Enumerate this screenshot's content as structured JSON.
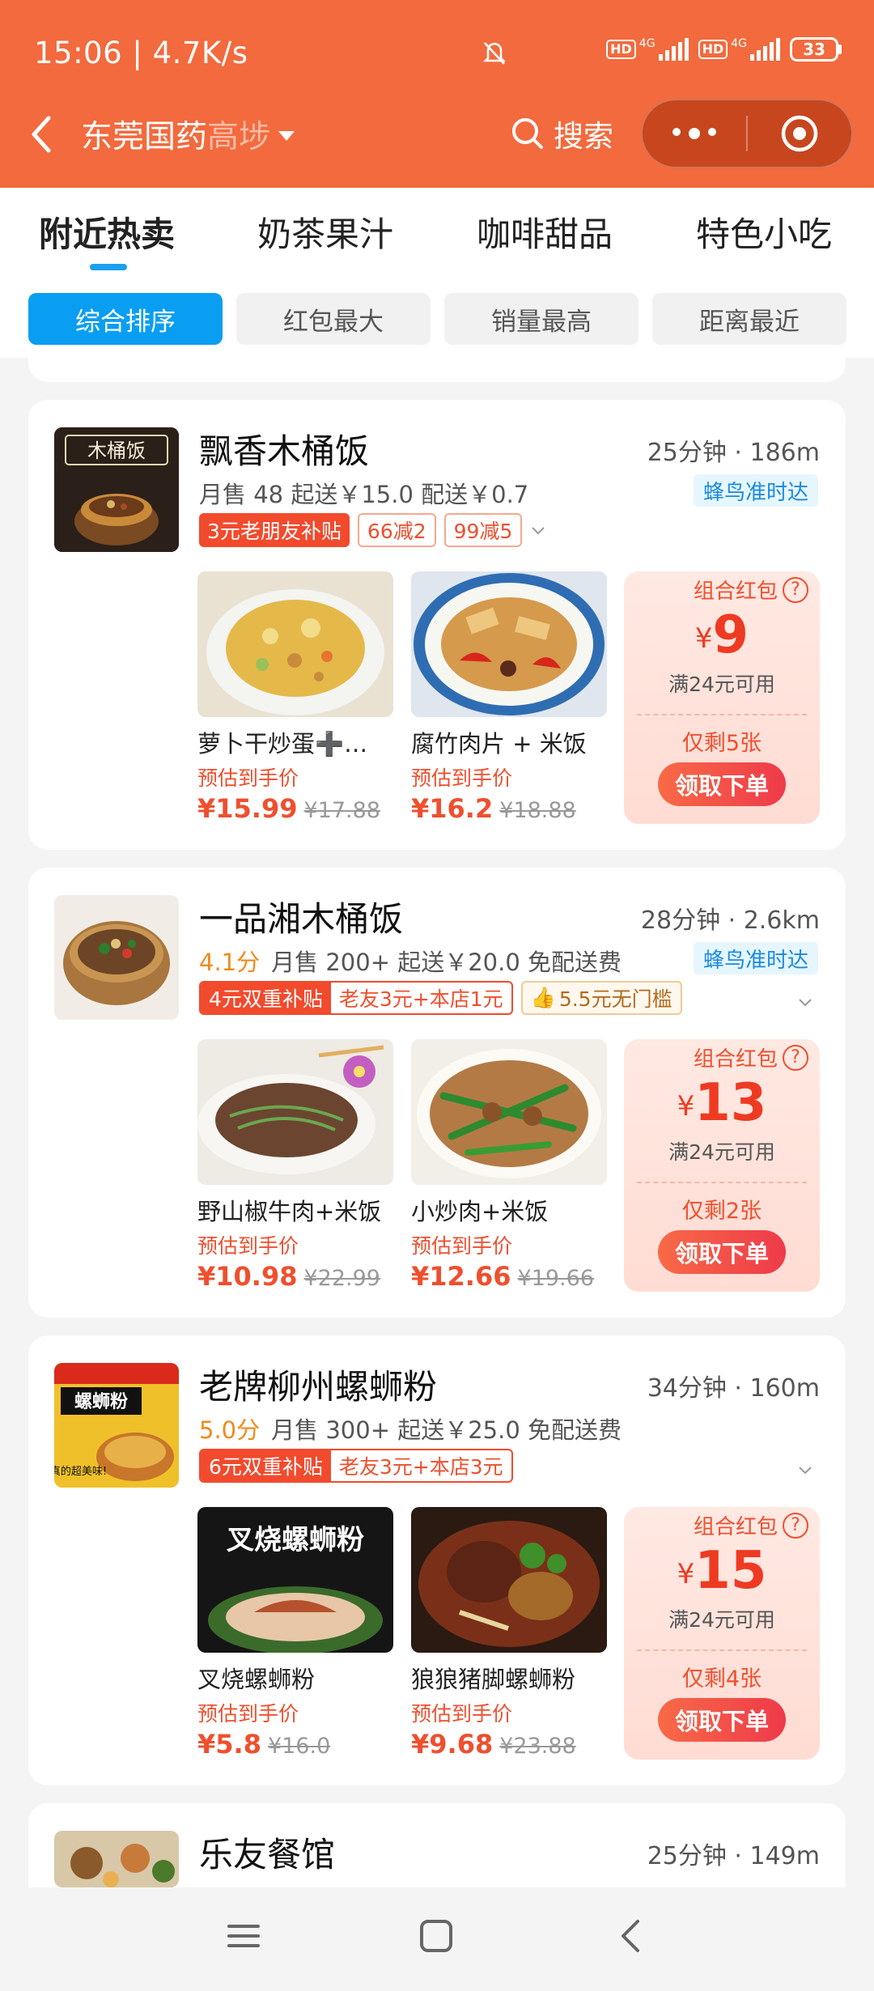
{
  "status": {
    "time": "15:06 | 4.7K/s",
    "battery": "33",
    "hd1": "HD",
    "net1": "4G",
    "hd2": "HD",
    "net2": "4G"
  },
  "nav": {
    "location_main": "东莞国药",
    "location_fade": "高埗",
    "search_label": "搜索"
  },
  "categories": [
    "附近热卖",
    "奶茶果汁",
    "咖啡甜品",
    "特色小吃"
  ],
  "filters": [
    "综合排序",
    "红包最大",
    "销量最高",
    "距离最近"
  ],
  "stores": [
    {
      "name": "飘香木桶饭",
      "eta": "25分钟 · 186m",
      "score": "",
      "meta": "月售 48  起送￥15.0  配送￥0.7",
      "badge": "蜂鸟准时达",
      "tags": [
        "3元老朋友补贴",
        "66减2",
        "99减5"
      ],
      "logo_text": "木桶饭",
      "dishes": [
        {
          "name": "萝卜干炒蛋➕…",
          "price_label": "预估到手价",
          "price": "¥15.99",
          "orig": "¥17.88"
        },
        {
          "name": "腐竹肉片 + 米饭",
          "price_label": "预估到手价",
          "price": "¥16.2",
          "orig": "¥18.88"
        }
      ],
      "coupon": {
        "title": "组合红包",
        "currency": "¥",
        "amount": "9",
        "cond": "满24元可用",
        "left": "仅剩5张",
        "action": "领取下单"
      }
    },
    {
      "name": "一品湘木桶饭",
      "eta": "28分钟 · 2.6km",
      "score": "4.1分",
      "meta": "月售 200+  起送￥20.0  免配送费",
      "badge": "蜂鸟准时达",
      "tag_combo": {
        "a": "4元双重补贴",
        "b": "老友3元+本店1元"
      },
      "tag_gold": "5.5元无门槛",
      "dishes": [
        {
          "name": "野山椒牛肉+米饭",
          "price_label": "预估到手价",
          "price": "¥10.98",
          "orig": "¥22.99"
        },
        {
          "name": "小炒肉+米饭",
          "price_label": "预估到手价",
          "price": "¥12.66",
          "orig": "¥19.66"
        }
      ],
      "coupon": {
        "title": "组合红包",
        "currency": "¥",
        "amount": "13",
        "cond": "满24元可用",
        "left": "仅剩2张",
        "action": "领取下单"
      }
    },
    {
      "name": "老牌柳州螺蛳粉",
      "eta": "34分钟 · 160m",
      "score": "5.0分",
      "meta": "月售 300+  起送￥25.0  免配送费",
      "tag_combo": {
        "a": "6元双重补贴",
        "b": "老友3元+本店3元"
      },
      "logo_text": "螺蛳粉",
      "logo_small": "真的超美味!",
      "dish1_art": "叉烧螺蛳粉",
      "dishes": [
        {
          "name": "叉烧螺蛳粉",
          "price_label": "预估到手价",
          "price": "¥5.8",
          "orig": "¥16.0"
        },
        {
          "name": "狼狼猪脚螺蛳粉",
          "price_label": "预估到手价",
          "price": "¥9.68",
          "orig": "¥23.88"
        }
      ],
      "coupon": {
        "title": "组合红包",
        "currency": "¥",
        "amount": "15",
        "cond": "满24元可用",
        "left": "仅剩4张",
        "action": "领取下单"
      }
    },
    {
      "name": "乐友餐馆",
      "eta": "25分钟 · 149m"
    }
  ],
  "colors": {
    "brand": "#f26a3d",
    "accent_blue": "#0a9ef2",
    "price_red": "#ef4f2e"
  }
}
